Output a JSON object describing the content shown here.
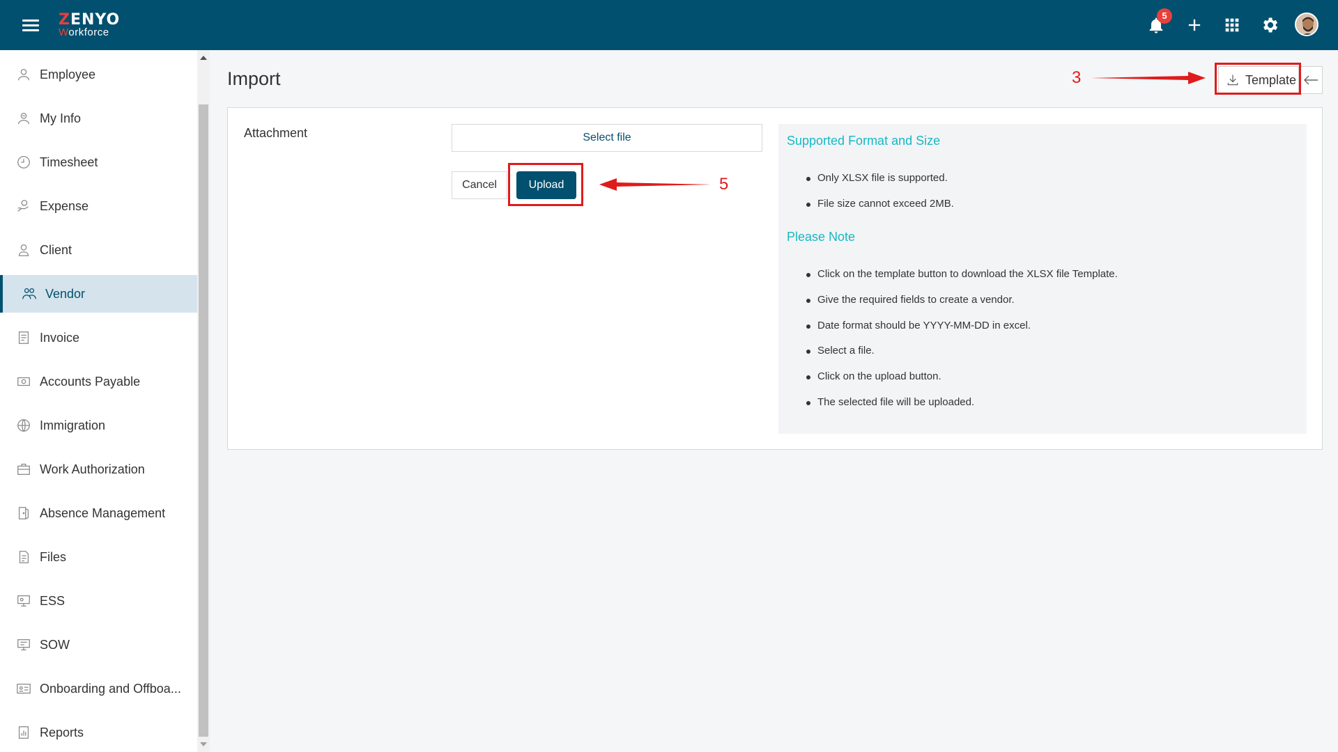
{
  "header": {
    "logo_brand": "ZENYO",
    "logo_brand_first": "Z",
    "logo_brand_rest": "ENYO",
    "logo_sub_first": "W",
    "logo_sub_rest": "orkforce",
    "notification_count": "5",
    "accent_color": "#02506f",
    "icons": [
      "menu-icon",
      "bell-icon",
      "plus-icon",
      "apps-grid-icon",
      "gear-icon",
      "avatar"
    ]
  },
  "sidebar": {
    "items": [
      {
        "label": "Employee",
        "icon": "employee-icon"
      },
      {
        "label": "My Info",
        "icon": "user-info-icon"
      },
      {
        "label": "Timesheet",
        "icon": "clock-icon"
      },
      {
        "label": "Expense",
        "icon": "expense-icon"
      },
      {
        "label": "Client",
        "icon": "client-icon"
      },
      {
        "label": "Vendor",
        "icon": "vendor-icon",
        "active": true
      },
      {
        "label": "Invoice",
        "icon": "invoice-icon"
      },
      {
        "label": "Accounts Payable",
        "icon": "accounts-payable-icon"
      },
      {
        "label": "Immigration",
        "icon": "immigration-icon"
      },
      {
        "label": "Work Authorization",
        "icon": "briefcase-icon"
      },
      {
        "label": "Absence Management",
        "icon": "door-icon"
      },
      {
        "label": "Files",
        "icon": "files-icon"
      },
      {
        "label": "ESS",
        "icon": "ess-icon"
      },
      {
        "label": "SOW",
        "icon": "sow-icon"
      },
      {
        "label": "Onboarding and Offboa...",
        "icon": "id-card-icon"
      },
      {
        "label": "Reports",
        "icon": "reports-icon"
      }
    ]
  },
  "main": {
    "title": "Import",
    "template_label": "Template",
    "attachment_label": "Attachment",
    "select_file_label": "Select file",
    "cancel_label": "Cancel",
    "upload_label": "Upload",
    "info": {
      "heading1": "Supported Format and Size",
      "list1": [
        "Only XLSX file is supported.",
        "File size cannot exceed 2MB."
      ],
      "heading2": "Please Note",
      "list2": [
        "Click on the template button to download the XLSX file Template.",
        "Give the required fields to create a vendor.",
        "Date format should be YYYY-MM-DD in excel.",
        "Select a file.",
        "Click on the upload button.",
        "The selected file will be uploaded."
      ]
    }
  },
  "annotations": {
    "step_template": "3",
    "step_upload": "5",
    "color": "#e01b1b"
  }
}
